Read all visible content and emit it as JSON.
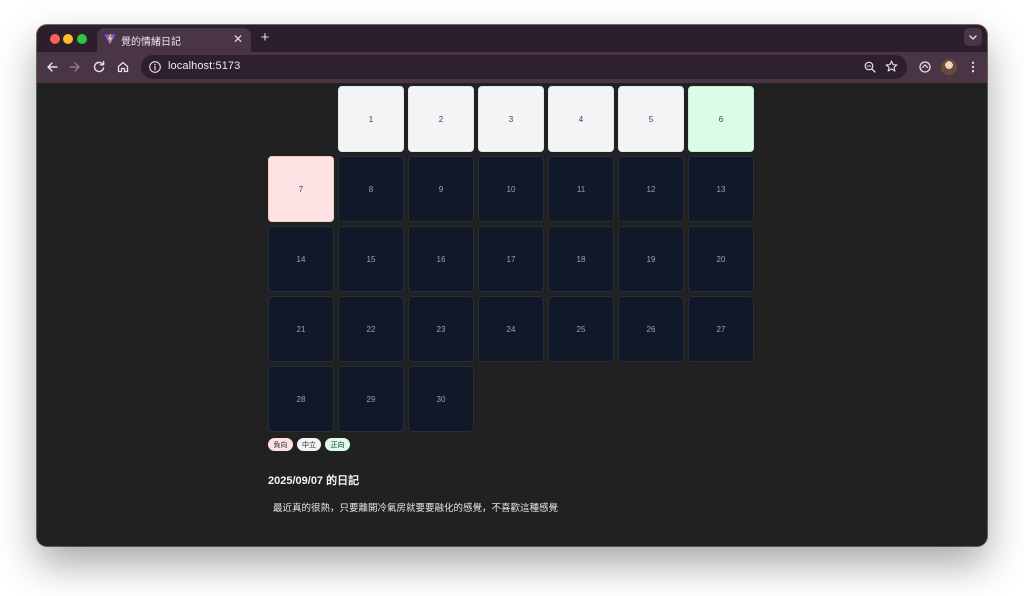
{
  "browser": {
    "tab_title": "覺的情緒日記",
    "tab_close": "✕",
    "new_tab": "+",
    "url": "localhost:5173"
  },
  "calendar": {
    "days": [
      {
        "label": "1",
        "mood": "neutral"
      },
      {
        "label": "2",
        "mood": "neutral"
      },
      {
        "label": "3",
        "mood": "neutral"
      },
      {
        "label": "4",
        "mood": "neutral"
      },
      {
        "label": "5",
        "mood": "neutral"
      },
      {
        "label": "6",
        "mood": "positive"
      },
      {
        "label": "7",
        "mood": "negative"
      },
      {
        "label": "8",
        "mood": "none"
      },
      {
        "label": "9",
        "mood": "none"
      },
      {
        "label": "10",
        "mood": "none"
      },
      {
        "label": "11",
        "mood": "none"
      },
      {
        "label": "12",
        "mood": "none"
      },
      {
        "label": "13",
        "mood": "none"
      },
      {
        "label": "14",
        "mood": "none"
      },
      {
        "label": "15",
        "mood": "none"
      },
      {
        "label": "16",
        "mood": "none"
      },
      {
        "label": "17",
        "mood": "none"
      },
      {
        "label": "18",
        "mood": "none"
      },
      {
        "label": "19",
        "mood": "none"
      },
      {
        "label": "20",
        "mood": "none"
      },
      {
        "label": "21",
        "mood": "none"
      },
      {
        "label": "22",
        "mood": "none"
      },
      {
        "label": "23",
        "mood": "none"
      },
      {
        "label": "24",
        "mood": "none"
      },
      {
        "label": "25",
        "mood": "none"
      },
      {
        "label": "26",
        "mood": "none"
      },
      {
        "label": "27",
        "mood": "none"
      },
      {
        "label": "28",
        "mood": "none"
      },
      {
        "label": "29",
        "mood": "none"
      },
      {
        "label": "30",
        "mood": "none"
      }
    ]
  },
  "legend": {
    "negative": "負向",
    "neutral": "中立",
    "positive": "正向"
  },
  "diary": {
    "title": "2025/09/07 的日記",
    "content": "最近真的很熱，只要離開冷氣房就要要融化的感覺，不喜歡這種感覺"
  },
  "colors": {
    "neutral": "#f3f4f6",
    "positive": "#dcfce7",
    "negative": "#fce2e2",
    "empty": "#111827",
    "background": "#212121"
  }
}
